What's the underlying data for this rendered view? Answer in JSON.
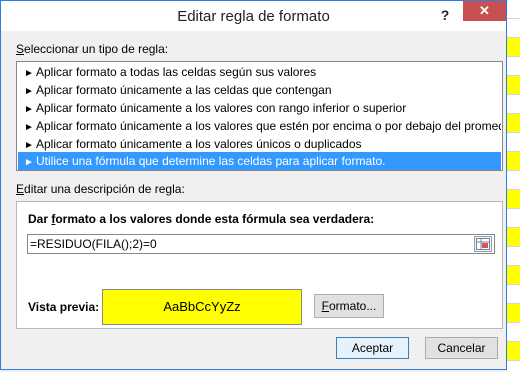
{
  "dialog": {
    "title": "Editar regla de formato",
    "help_glyph": "?",
    "close_glyph": "✕"
  },
  "rule_type": {
    "label_underlined": "S",
    "label_rest": "eleccionar un tipo de regla:",
    "items": [
      {
        "label": "Aplicar formato a todas las celdas según sus valores",
        "selected": false
      },
      {
        "label": "Aplicar formato únicamente a las celdas que contengan",
        "selected": false
      },
      {
        "label": "Aplicar formato únicamente a los valores con rango inferior o superior",
        "selected": false
      },
      {
        "label": "Aplicar formato únicamente a los valores que estén por encima o por debajo del promedio",
        "selected": false
      },
      {
        "label": "Aplicar formato únicamente a los valores únicos o duplicados",
        "selected": false
      },
      {
        "label": "Utilice una fórmula que determine las celdas para aplicar formato.",
        "selected": true
      }
    ],
    "arrow_glyph": "►"
  },
  "description": {
    "label_underlined": "E",
    "label_rest": "ditar una descripción de regla:",
    "formula_label_pre": "Dar ",
    "formula_label_underlined": "f",
    "formula_label_post": "ormato a los valores donde esta fórmula sea verdadera:",
    "formula_value": "=RESIDUO(FILA();2)=0",
    "preview_label": "Vista previa:",
    "preview_sample": "AaBbCcYyZz",
    "preview_color": "#ffff00",
    "format_button_underlined": "F",
    "format_button_rest": "ormato..."
  },
  "footer": {
    "accept_label": "Aceptar",
    "cancel_label": "Cancelar"
  }
}
